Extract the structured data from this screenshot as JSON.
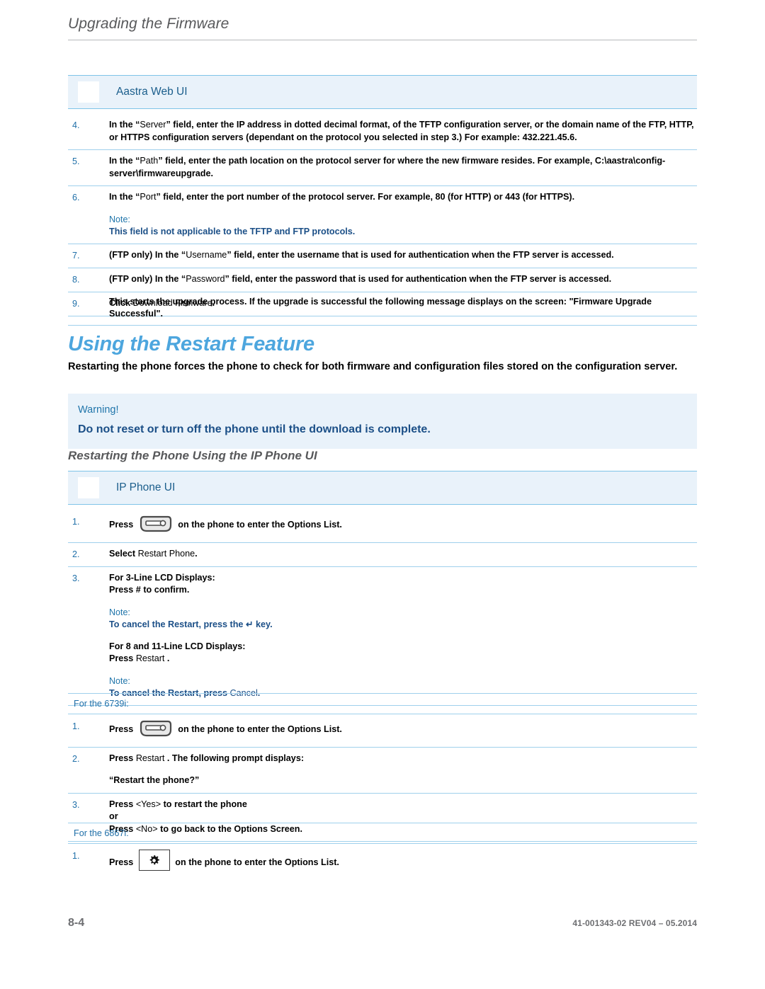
{
  "header": {
    "running_title": "Upgrading the Firmware"
  },
  "web_ui_banner": {
    "label": "Aastra Web UI",
    "icon": "ui-placeholder-icon"
  },
  "web_ui_steps": [
    {
      "num": "4.",
      "parts": [
        {
          "t": "In the “",
          "b": true
        },
        {
          "t": "Server",
          "b": false
        },
        {
          "t": "” field, enter the IP address in dotted decimal format, of the TFTP configuration server, or the domain name of the FTP, HTTP, or HTTPS configuration servers (dependant on the protocol you selected in step 3.) For example: 432.221.45.6.",
          "b": true
        }
      ]
    },
    {
      "num": "5.",
      "parts": [
        {
          "t": "In the “",
          "b": true
        },
        {
          "t": "Path",
          "b": false
        },
        {
          "t": "” field, enter the path location on the protocol server for where the new firmware resides. For example, C:\\aastra\\config-server\\firmwareupgrade.",
          "b": true
        }
      ]
    },
    {
      "num": "6.",
      "parts": [
        {
          "t": "In the “",
          "b": true
        },
        {
          "t": "Port",
          "b": false
        },
        {
          "t": "” field, enter the port number of the protocol server. For example, 80 (for HTTP) or 443 (for HTTPS).",
          "b": true
        }
      ],
      "note": {
        "label": "Note:",
        "text": "This field is not applicable to the TFTP and FTP protocols."
      }
    },
    {
      "num": "7.",
      "parts": [
        {
          "t": "(FTP only) In the “",
          "b": true
        },
        {
          "t": "Username",
          "b": false
        },
        {
          "t": "” field, enter the username that is used for authentication when the FTP server is accessed.",
          "b": true
        }
      ]
    },
    {
      "num": "8.",
      "parts": [
        {
          "t": "(FTP only) In the “",
          "b": true
        },
        {
          "t": "Password",
          "b": false
        },
        {
          "t": "” field, enter the password that is used for authentication when the FTP server is accessed.",
          "b": true
        }
      ]
    },
    {
      "num": "9.",
      "parts": [
        {
          "t": "Click ",
          "b": true
        },
        {
          "t": "Download Firmware",
          "b": false
        },
        {
          "t": ".",
          "b": true
        }
      ]
    }
  ],
  "result_text": "This starts the upgrade process. If the upgrade is successful the following message displays on the screen: \"Firmware Upgrade Successful\".",
  "restart_section": {
    "heading": "Using the Restart Feature",
    "intro": "Restarting the phone forces the phone to check for both firmware and configuration files stored on the configuration server.",
    "warning_label": "Warning!",
    "warning_text": "Do not reset or turn off the phone until the download is complete.",
    "subheading": "Restarting the Phone Using the IP Phone UI"
  },
  "phone_ui_banner": {
    "label": "IP Phone UI",
    "icon": "ui-placeholder-icon"
  },
  "phone_ui_steps": [
    {
      "num": "1.",
      "pre": "Press",
      "icon": "options-key-icon",
      "post": "on the phone to enter the Options List."
    },
    {
      "num": "2.",
      "parts": [
        {
          "t": "Select ",
          "b": true
        },
        {
          "t": "Restart Phone",
          "b": false
        },
        {
          "t": ".",
          "b": true
        }
      ]
    },
    {
      "num": "3.",
      "lines": [
        "For 3-Line LCD Displays:",
        "Press # to confirm."
      ],
      "note1": {
        "label": "Note:",
        "pre": "To cancel the Restart, press the ",
        "sym": "↵",
        "post": " key."
      },
      "lines2": [
        "For 8 and 11-Line LCD Displays:"
      ],
      "press_restart": {
        "bold": "Press ",
        "lit": "Restart",
        "tail": "."
      },
      "note2": {
        "label": "Note:",
        "pre": "To cancel the Restart, press ",
        "lit": "Cancel",
        "post": "."
      }
    }
  ],
  "model_6739i": {
    "banner": "For the 6739i:",
    "steps": [
      {
        "num": "1.",
        "pre": "Press",
        "icon": "options-key-icon",
        "post": "on the phone to enter the Options List."
      },
      {
        "num": "2.",
        "bold1": "Press ",
        "lit": "Restart",
        "bold2": ". The following prompt displays:",
        "prompt": "“Restart the phone?”"
      },
      {
        "num": "3.",
        "line1_bold": "Press ",
        "line1_lit": "<Yes>",
        "line1_tail": " to restart the phone",
        "or": "or",
        "line2_bold": "Press ",
        "line2_lit": "<No>",
        "line2_tail": " to go back to the Options Screen."
      }
    ]
  },
  "model_6867i": {
    "banner": "For the 6867i:",
    "steps": [
      {
        "num": "1.",
        "pre": "Press",
        "icon": "gear-key-icon",
        "post": "on the phone to enter the Options List."
      }
    ]
  },
  "footer": {
    "page_number": "8-4",
    "doc_id": "41-001343-02 REV04 – 05.2014"
  },
  "colors": {
    "accent_blue": "#4da6de",
    "banner_bg": "#e9f2fa",
    "banner_border": "#7fc4e8",
    "rule": "#9fd0ec",
    "note_blue": "#1b4f87",
    "gray": "#58595b"
  }
}
